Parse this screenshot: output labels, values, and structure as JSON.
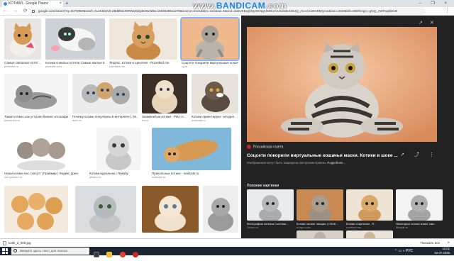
{
  "browser": {
    "tab_title": "КОТИКИ - Google Поиск",
    "tab_close": "×",
    "new_tab": "+",
    "window_controls": "– ❐ ×",
    "url": "google.com/search?q=КОТИКИ&sxsrf=ALeKk02V8-Z8dbl5ZJGRW1M2ipDz8uW8w:1593638911270&source=lnms&tbm=isch&sa=X&ved=2ahUKEwjSlvjJ5KNqAhWK2AKHdmBvCBUQ_AUoAXoECBMQAw&biw=1920&bih=969#imgrc=gGQ_eWFwp6bGM",
    "nav_buttons": "← → ⟳",
    "menu_glyph": "⋮"
  },
  "watermark": {
    "prefix": "www.",
    "brand": "BANDICAM",
    "suffix": ".com"
  },
  "results": [
    {
      "caption": "Самые смешные котят…",
      "source": "pinterest.ru"
    },
    {
      "caption": "Котики в милых котята! Самые милые в...",
      "source": "youtube.com"
    },
    {
      "caption": "Яндекс, котики и щеночки - Rozetked.me",
      "source": "rozetked.me"
    },
    {
      "caption": "Соцсети покорили виртуальные кошачьи…",
      "source": "rg.ru"
    },
    {
      "caption": "Такие котики: как устроен бизнес котокафе...",
      "source": "kuban.rbc.ru"
    },
    {
      "caption": "Почему котики популярны в интернете | Ля...",
      "source": "dzen.ru"
    },
    {
      "caption": "Знаменитые котики - РИА Н...",
      "source": "ria.ru"
    },
    {
      "caption": "Котики ориентируют сегодня ...",
      "source": "svoboda.ru"
    },
    {
      "caption": "Наши котики нас спасут! | Правмир | Яндекс Дзен",
      "source": "zen.yandex.ru"
    },
    {
      "caption": "Котики идеальны | Пикабу",
      "source": "pikabu.ru"
    },
    {
      "caption": "Прикольные котики - mailcats.ru",
      "source": "mailcats.ru"
    },
    {
      "caption": "",
      "source": ""
    },
    {
      "caption": "",
      "source": ""
    },
    {
      "caption": "",
      "source": ""
    },
    {
      "caption": "",
      "source": ""
    }
  ],
  "panel": {
    "publisher": "Российская газета",
    "title": "Соцсети покорили виртуальные кошачьи маски. Котики в шоке ...",
    "copyright": "Изображения могут быть защищены авторским правом.",
    "copyright_link": "Подробнее...",
    "visit_glyph": "↗ ⤴ ⋮",
    "similar_label": "Похожие картинки",
    "similar": [
      {
        "caption": "Фотографии котенка Скоттиш...",
        "source": "1zoom.ru"
      },
      {
        "caption": "Котики читают эмоции | СЕКБ...",
        "source": "ecogrn.com"
      },
      {
        "caption": "Котики и щеночки - Я...",
        "source": "rozetked.me"
      },
      {
        "caption": "Некоторые котики знают сам...",
        "source": "lifestyle.ru"
      }
    ]
  },
  "downloads": {
    "file": "kotik_d_000.jpg",
    "show_all": "Показать все",
    "close": "×"
  },
  "taskbar": {
    "search_placeholder": "Введите здесь текст для поиска",
    "tray_icons": "⌃ ▭ ◖ РУС",
    "time": "10:02",
    "date": "02.07.2020"
  }
}
